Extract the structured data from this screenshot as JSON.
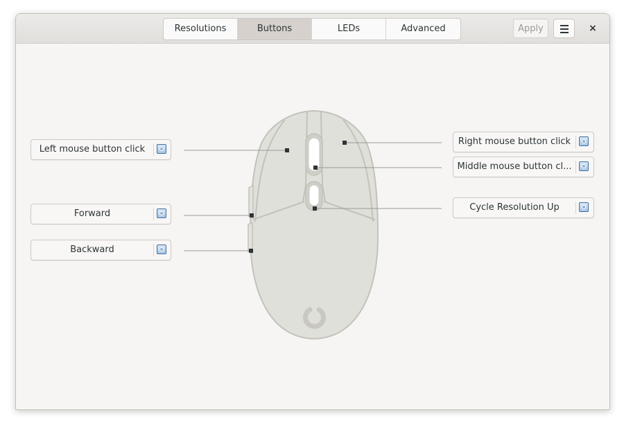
{
  "tabs": [
    {
      "label": "Resolutions"
    },
    {
      "label": "Buttons",
      "active": true
    },
    {
      "label": "LEDs"
    },
    {
      "label": "Advanced"
    }
  ],
  "header": {
    "apply_label": "Apply",
    "close_label": "×"
  },
  "buttons": {
    "left_click": "Left mouse button click",
    "forward": "Forward",
    "backward": "Backward",
    "right_click": "Right mouse button click",
    "middle_click": "Middle mouse button cl...",
    "cycle_resolution": "Cycle Resolution Up"
  },
  "icons": {
    "button_config": "settings-icon",
    "menu": "hamburger-menu-icon",
    "close": "close-icon"
  },
  "colors": {
    "accent": "#3d6fa3",
    "active_tab": "#d6d1cd",
    "mouse_body": "#e0e0da"
  }
}
